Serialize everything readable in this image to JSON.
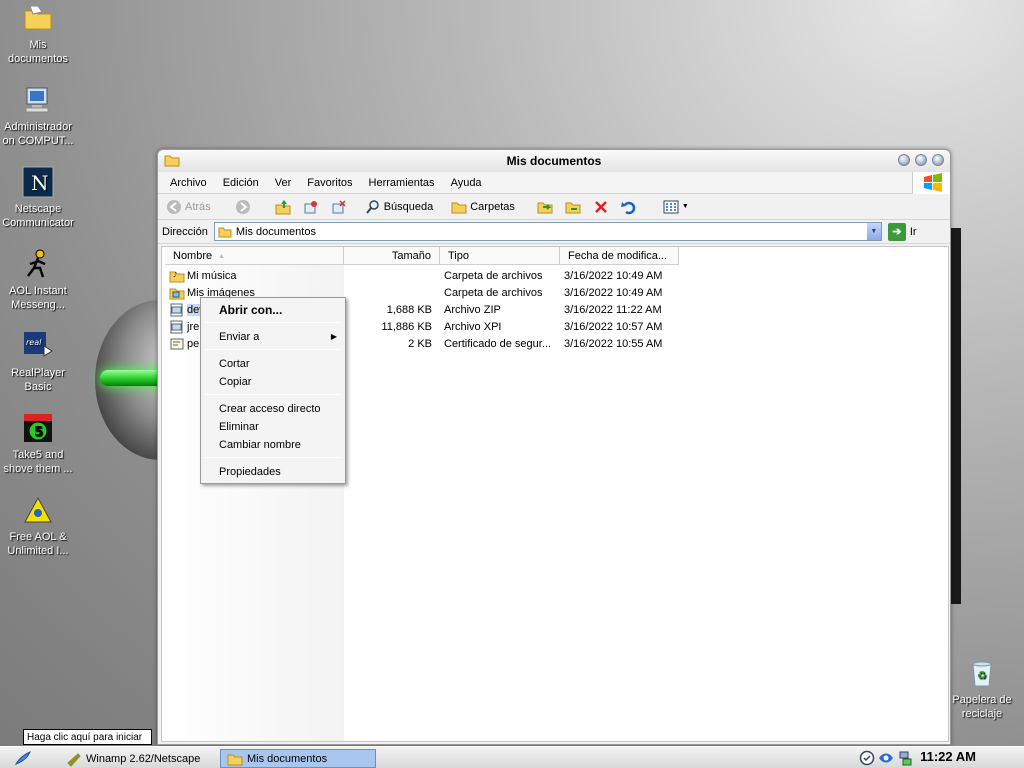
{
  "desktop": {
    "icons": [
      {
        "label": "Mis documentos",
        "icon": "folder-icon"
      },
      {
        "label": "Administrador on COMPUT...",
        "icon": "computer-icon"
      },
      {
        "label": "Netscape Communicator",
        "icon": "netscape-icon"
      },
      {
        "label": "AOL Instant Messeng...",
        "icon": "aim-icon"
      },
      {
        "label": "RealPlayer Basic",
        "icon": "realplayer-icon"
      },
      {
        "label": "Take5 and shove them ...",
        "icon": "take5-icon"
      },
      {
        "label": "Free AOL & Unlimited I...",
        "icon": "aol-icon"
      }
    ],
    "recycle_bin": "Papelera de reciclaje"
  },
  "window": {
    "title": "Mis documentos",
    "menu": [
      "Archivo",
      "Edición",
      "Ver",
      "Favoritos",
      "Herramientas",
      "Ayuda"
    ],
    "toolbar": {
      "back": "Atrás",
      "search": "Búsqueda",
      "folders": "Carpetas"
    },
    "address": {
      "label": "Dirección",
      "value": "Mis documentos",
      "go": "Ir"
    },
    "columns": [
      "Nombre",
      "Tamaño",
      "Tipo",
      "Fecha de modifica..."
    ],
    "files": [
      {
        "name": "Mi música",
        "size": "",
        "type": "Carpeta de archivos",
        "date": "3/16/2022 10:49 AM"
      },
      {
        "name": "Mis imágenes",
        "size": "",
        "type": "Carpeta de archivos",
        "date": "3/16/2022 10:49 AM"
      },
      {
        "name": "dev",
        "size": "1,688 KB",
        "type": "Archivo ZIP",
        "date": "3/16/2022 11:22 AM"
      },
      {
        "name": "jre1",
        "size": "11,886 KB",
        "type": "Archivo XPI",
        "date": "3/16/2022 10:57 AM"
      },
      {
        "name": "pen",
        "size": "2 KB",
        "type": "Certificado de segur...",
        "date": "3/16/2022 10:55 AM"
      }
    ]
  },
  "context_menu": {
    "open_with": "Abrir con...",
    "send_to": "Enviar a",
    "cut": "Cortar",
    "copy": "Copiar",
    "create_shortcut": "Crear acceso directo",
    "delete": "Eliminar",
    "rename": "Cambiar nombre",
    "properties": "Propiedades"
  },
  "taskbar": {
    "tooltip": "Haga clic aquí para iniciar",
    "tasks": [
      "Winamp 2.62/Netscape",
      "Mis documentos"
    ],
    "clock": "11:22 AM"
  }
}
